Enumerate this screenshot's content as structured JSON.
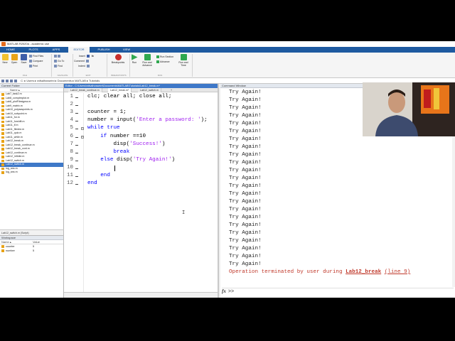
{
  "window": {
    "title": "MATLAB R2020a - academic use"
  },
  "ribbon": {
    "tabs": [
      "HOME",
      "PLOTS",
      "APPS",
      "EDITOR",
      "PUBLISH",
      "VIEW"
    ],
    "active_tab": "EDITOR",
    "file": {
      "new": "New",
      "open": "Open",
      "save": "Save",
      "find_files": "Find Files",
      "compare": "Compare",
      "print": "Print",
      "group": "FILE"
    },
    "navigate": {
      "go_to": "Go To",
      "find": "Find",
      "group": "NAVIGATE"
    },
    "edit": {
      "insert": "Insert",
      "comment": "Comment",
      "indent": "Indent",
      "group": "EDIT"
    },
    "breakpoints": {
      "label": "Breakpoints",
      "group": "BREAKPOINTS"
    },
    "run": {
      "run": "Run",
      "run_and_advance": "Run and Advance",
      "run_section": "Run Section",
      "advance": "Advance",
      "run_and_time": "Run and Time",
      "group": "RUN"
    }
  },
  "address_bar": {
    "path": "C: ▸ Users ▸ rafsalhosseini ▸ Documents ▸ MATLAB ▸ Tutorials"
  },
  "current_folder": {
    "title": "Current Folder",
    "column": "Name ▴",
    "files": [
      "Lab7_task2.m",
      "Lab8_complexplot.m",
      "Lab8_plotFilesigma.m",
      "Lab9_matrix.m",
      "Lab10_polysaspoints.m",
      "Lab10_subpoint.m",
      "Lab11_for.m",
      "Lab11_forshift.m",
      "Lab11_if.m",
      "Lab11_filesfor.m",
      "Lab11_quiz.m",
      "Lab11_while.m",
      "Lab12_break.m",
      "Lab12_break_continue.m",
      "Lab12_break_cont.m",
      "Lab12_continue.m",
      "Lab12_infinite.m",
      "Lab12_switch.m",
      "Lab12_switch.m",
      "log_ans.m",
      "log_ans.m"
    ],
    "selected_index": 18,
    "details": "Lab12_switch.m (Script)"
  },
  "workspace": {
    "title": "Workspace",
    "columns": [
      "Name ▴",
      "Value"
    ],
    "vars": [
      {
        "name": "counter",
        "value": "5"
      },
      {
        "name": "number",
        "value": "5"
      }
    ]
  },
  "editor": {
    "title": "Editor - C:\\Users\\rafsalhosseini\\Documents\\MATLAB\\Tutorials\\Lab12_break.m*",
    "tabs": [
      "Lab12_break_continue.m",
      "Lab12_break.m*",
      "Lab12_switch.m"
    ],
    "active_tab": 1,
    "add_tab": "+",
    "lines": [
      {
        "n": "1",
        "text": "clc; clear all; close all;"
      },
      {
        "n": "2",
        "text": ""
      },
      {
        "n": "3",
        "text": "counter = 1;"
      },
      {
        "n": "4",
        "text": "number = input('Enter a password: ');"
      },
      {
        "n": "5",
        "text": "while true"
      },
      {
        "n": "6",
        "text": "    if number ==10"
      },
      {
        "n": "7",
        "text": "        disp('Success!')"
      },
      {
        "n": "8",
        "text": "        break"
      },
      {
        "n": "9",
        "text": "    else disp('Try Again!')"
      },
      {
        "n": "10",
        "text": ""
      },
      {
        "n": "11",
        "text": "    end"
      },
      {
        "n": "12",
        "text": "end"
      }
    ]
  },
  "command_window": {
    "title": "Command Window",
    "repeat_line": "Try Again!",
    "repeat_count": 23,
    "error_prefix": "Operation terminated by user during ",
    "error_fn": "Lab12_break",
    "error_link": "(line 9)",
    "prompt_fx": "fx",
    "prompt": ">>"
  }
}
